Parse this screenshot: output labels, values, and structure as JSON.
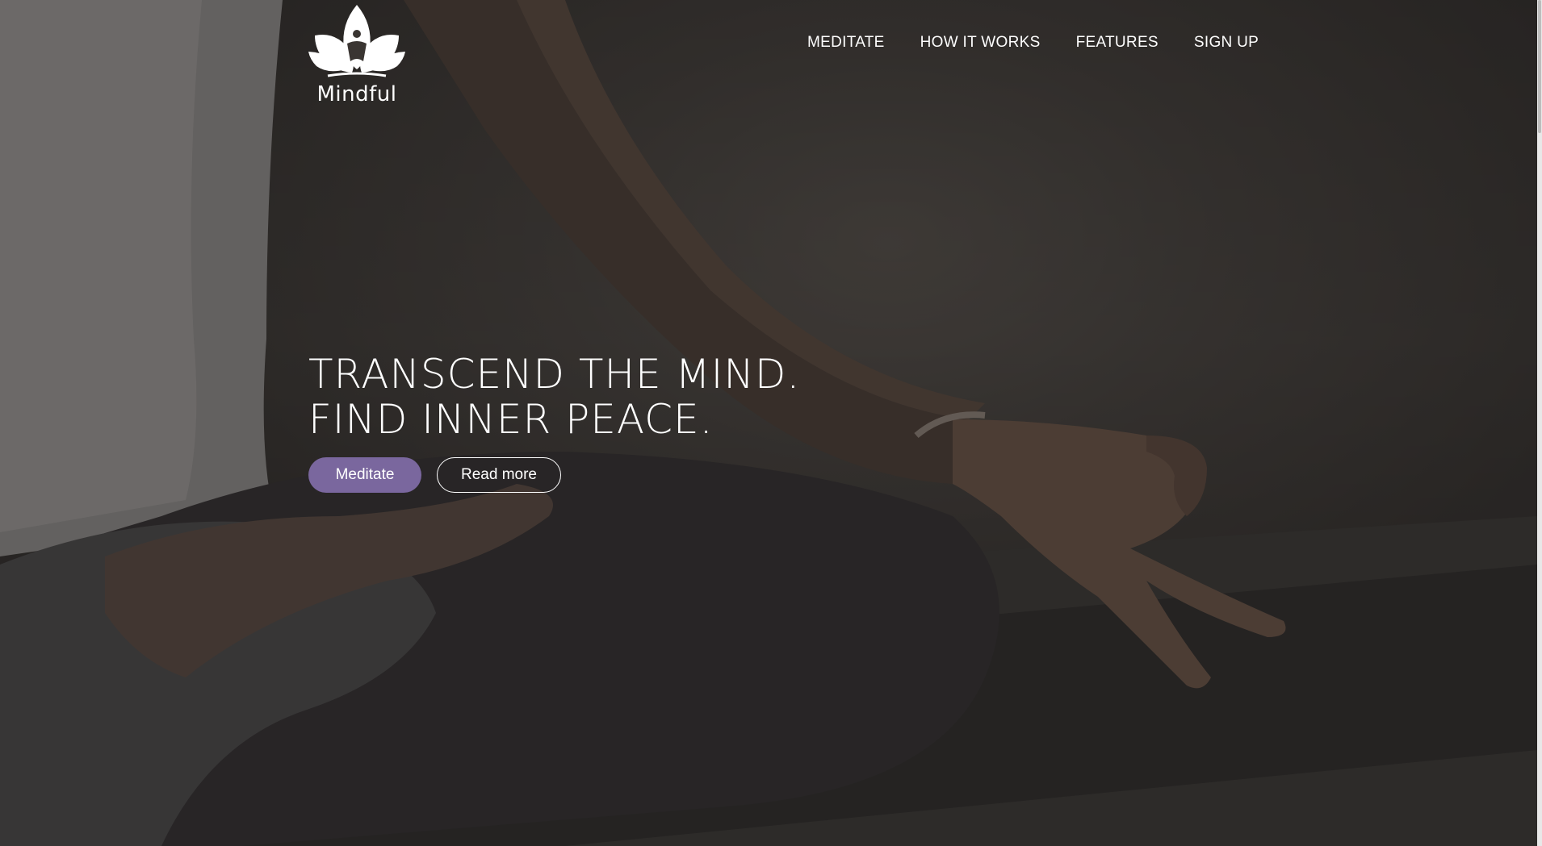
{
  "brand": {
    "name": "Mindful",
    "logo_icon": "lotus-meditation-icon"
  },
  "nav": {
    "items": [
      {
        "label": "MEDITATE"
      },
      {
        "label": "HOW IT WORKS"
      },
      {
        "label": "FEATURES"
      },
      {
        "label": "SIGN UP"
      }
    ]
  },
  "hero": {
    "headline_line1": "TRANSCEND THE MIND.",
    "headline_line2": "FIND INNER PEACE.",
    "primary_button": "Meditate",
    "secondary_button": "Read more",
    "background_image": "person-meditating-photo"
  },
  "colors": {
    "accent": "#7a679e",
    "text": "#ffffff"
  }
}
